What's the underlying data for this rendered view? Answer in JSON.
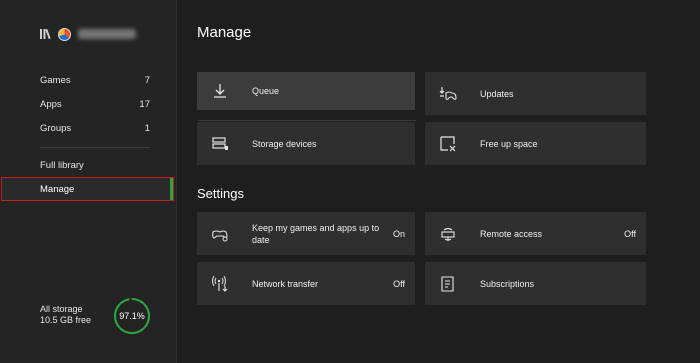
{
  "sidebar": {
    "counts": [
      {
        "label": "Games",
        "count": "7"
      },
      {
        "label": "Apps",
        "count": "17"
      },
      {
        "label": "Groups",
        "count": "1"
      }
    ],
    "full_library": "Full library",
    "manage": "Manage",
    "storage": {
      "title": "All storage",
      "free": "10.5 GB free",
      "percent_text": "97.1%",
      "percent": 97.1
    }
  },
  "main": {
    "title": "Manage",
    "tiles": {
      "queue": "Queue",
      "updates": "Updates",
      "storage_devices": "Storage devices",
      "free_up_space": "Free up space"
    },
    "settings_title": "Settings",
    "settings": {
      "keep_games": {
        "label": "Keep my games and apps up to date",
        "value": "On"
      },
      "remote_access": {
        "label": "Remote access",
        "value": "Off"
      },
      "network_transfer": {
        "label": "Network transfer",
        "value": "Off"
      },
      "subscriptions": {
        "label": "Subscriptions"
      }
    }
  },
  "colors": {
    "accent_green": "#2aa840",
    "focus_outline": "#c02222",
    "tile": "#2f2f2f"
  }
}
